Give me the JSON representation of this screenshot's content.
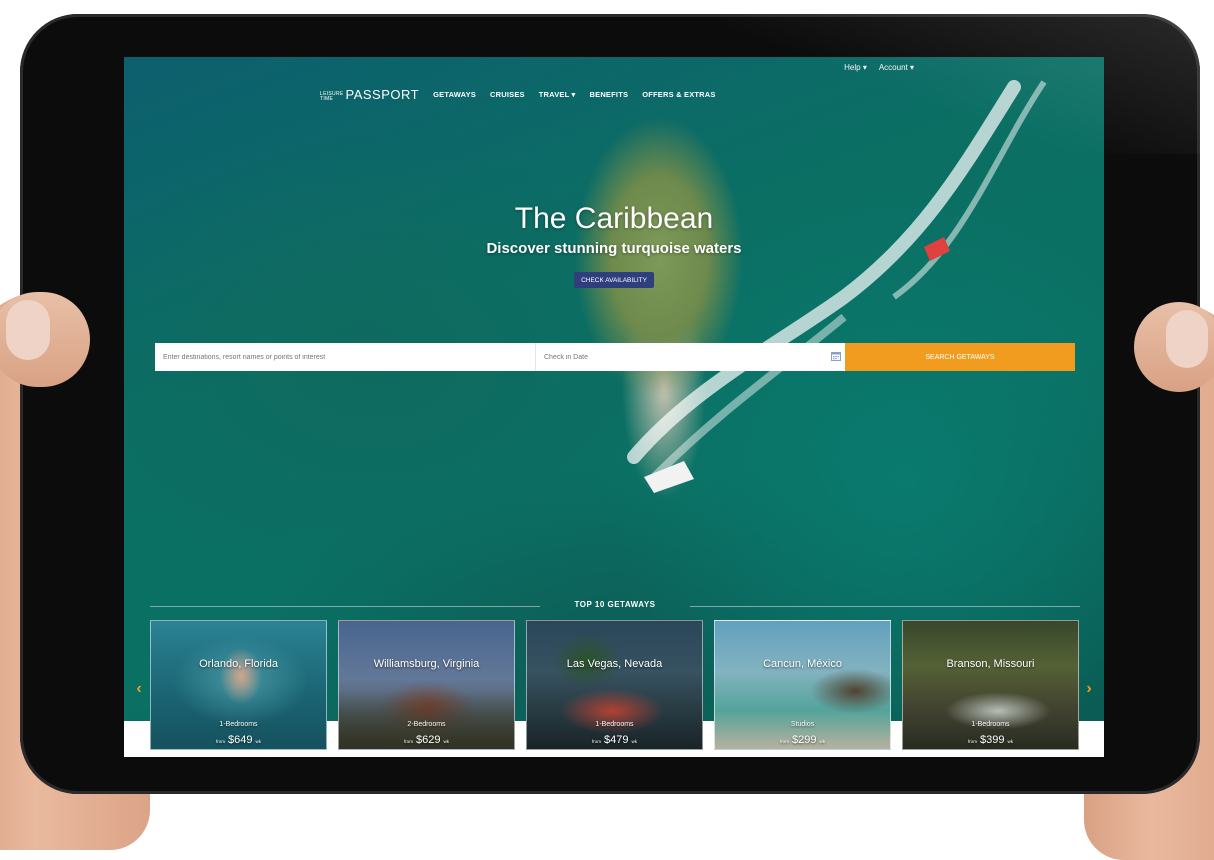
{
  "topbar": {
    "help": "Help ▾",
    "account": "Account ▾"
  },
  "nav": {
    "logo_small_line1": "LEISURE",
    "logo_small_line2": "TIME",
    "logo_big": "PASSPORT",
    "items": [
      "GETAWAYS",
      "CRUISES",
      "TRAVEL ▾",
      "BENEFITS",
      "OFFERS & EXTRAS"
    ]
  },
  "hero": {
    "title": "The Caribbean",
    "subtitle": "Discover stunning turquoise waters",
    "button": "CHECK AVAILABILITY"
  },
  "search": {
    "destination_placeholder": "Enter destinations, resort names or points of interest",
    "date_placeholder": "Check in Date",
    "button": "SEARCH GETAWAYS"
  },
  "top10": {
    "title": "TOP 10 GETAWAYS",
    "cards": [
      {
        "city": "Orlando, Florida",
        "bedrooms": "1-Bedrooms",
        "from": "from",
        "price": "$649",
        "per": "wk"
      },
      {
        "city": "Williamsburg, Virginia",
        "bedrooms": "2-Bedrooms",
        "from": "from",
        "price": "$629",
        "per": "wk"
      },
      {
        "city": "Las Vegas, Nevada",
        "bedrooms": "1-Bedrooms",
        "from": "from",
        "price": "$479",
        "per": "wk"
      },
      {
        "city": "Cancun, México",
        "bedrooms": "Studios",
        "from": "from",
        "price": "$299",
        "per": "wk"
      },
      {
        "city": "Branson, Missouri",
        "bedrooms": "1-Bedrooms",
        "from": "from",
        "price": "$399",
        "per": "wk"
      }
    ]
  },
  "icons": {
    "prev": "chevron-left-icon",
    "next": "chevron-right-icon",
    "calendar": "calendar-icon"
  },
  "colors": {
    "accent_orange": "#f29c1f",
    "button_navy": "#2f3f7d",
    "water": "#0b7064"
  }
}
